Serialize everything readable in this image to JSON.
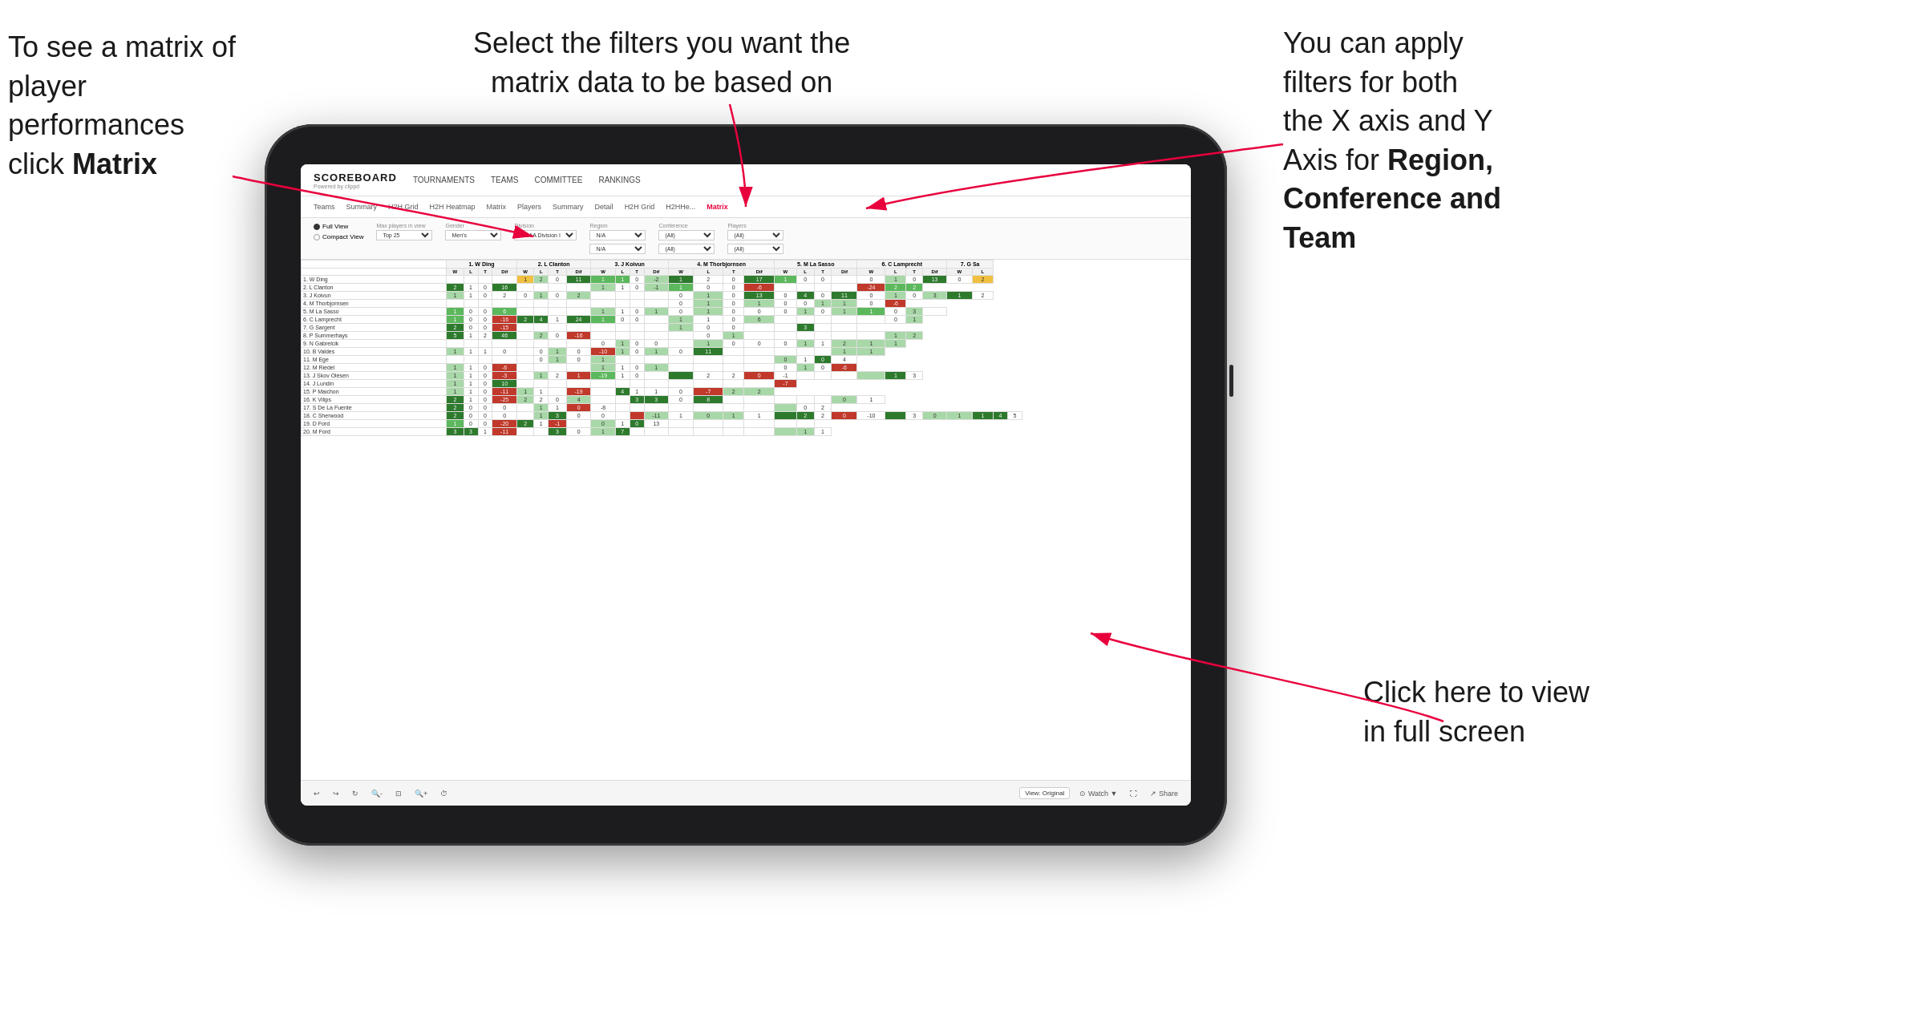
{
  "annotations": {
    "top_left": {
      "line1": "To see a matrix of",
      "line2": "player performances",
      "line3": "click ",
      "line3_bold": "Matrix"
    },
    "top_center": {
      "text": "Select the filters you want the\nmatrix data to be based on"
    },
    "top_right": {
      "line1": "You  can apply",
      "line2": "filters for both",
      "line3": "the X axis and Y",
      "line4_prefix": "Axis for ",
      "line4_bold": "Region,",
      "line5_bold": "Conference and",
      "line6_bold": "Team"
    },
    "bottom_right": {
      "line1": "Click here to view",
      "line2": "in full screen"
    }
  },
  "app": {
    "logo": "SCOREBOARD",
    "logo_sub": "Powered by clippd",
    "nav": [
      "TOURNAMENTS",
      "TEAMS",
      "COMMITTEE",
      "RANKINGS"
    ],
    "sub_nav": [
      "Teams",
      "Summary",
      "H2H Grid",
      "H2H Heatmap",
      "Matrix",
      "Players",
      "Summary",
      "Detail",
      "H2H Grid",
      "H2HHe...",
      "Matrix"
    ],
    "active_tab": "Matrix"
  },
  "filters": {
    "view_options": [
      "Full View",
      "Compact View"
    ],
    "active_view": "Full View",
    "max_players_label": "Max players in view",
    "max_players_value": "Top 25",
    "gender_label": "Gender",
    "gender_value": "Men's",
    "division_label": "Division",
    "division_value": "NCAA Division I",
    "region_label": "Region",
    "region_value": "N/A",
    "region_value2": "N/A",
    "conference_label": "Conference",
    "conference_value": "(All)",
    "conference_value2": "(All)",
    "players_label": "Players",
    "players_value": "(All)",
    "players_value2": "(All)"
  },
  "matrix": {
    "col_headers": [
      "1. W Ding",
      "2. L Clanton",
      "3. J Koivun",
      "4. M Thorbjornsen",
      "5. M La Sasso",
      "6. C Lamprecht",
      "7. G Sa"
    ],
    "sub_cols": [
      "W",
      "L",
      "T",
      "Dif"
    ],
    "rows": [
      {
        "name": "1. W Ding",
        "cells": [
          "",
          "",
          "",
          "",
          "1",
          "2",
          "0",
          "11",
          "1",
          "1",
          "0",
          "-2",
          "1",
          "2",
          "0",
          "17",
          "1",
          "0",
          "0",
          "",
          "0",
          "1",
          "0",
          "13",
          "0",
          "2"
        ]
      },
      {
        "name": "2. L Clanton",
        "cells": [
          "2",
          "1",
          "0",
          "16",
          "",
          "",
          "",
          "",
          "1",
          "1",
          "0",
          "-1",
          "1",
          "0",
          "0",
          "-6",
          "",
          "",
          "",
          "",
          "-24",
          "2",
          "2"
        ]
      },
      {
        "name": "3. J Koivun",
        "cells": [
          "1",
          "1",
          "0",
          "2",
          "0",
          "1",
          "0",
          "2",
          "",
          "",
          "",
          "",
          "0",
          "1",
          "0",
          "13",
          "0",
          "4",
          "0",
          "11",
          "0",
          "1",
          "0",
          "3",
          "1",
          "2"
        ]
      },
      {
        "name": "4. M Thorbjornsen",
        "cells": [
          "",
          "",
          "",
          "",
          "",
          "",
          "",
          "",
          "",
          "",
          "",
          "",
          "0",
          "1",
          "0",
          "1",
          "0",
          "0",
          "1",
          "1",
          "0",
          "-6"
        ]
      },
      {
        "name": "5. M La Sasso",
        "cells": [
          "1",
          "0",
          "0",
          "6",
          "",
          "",
          "",
          "",
          "1",
          "1",
          "0",
          "1",
          "0",
          "1",
          "0",
          "0",
          "0",
          "1",
          "0",
          "1",
          "1",
          "0",
          "3",
          ""
        ]
      },
      {
        "name": "6. C Lamprecht",
        "cells": [
          "1",
          "0",
          "0",
          "-16",
          "2",
          "4",
          "1",
          "24",
          "1",
          "0",
          "0",
          "",
          "1",
          "1",
          "0",
          "6",
          "",
          "",
          "",
          "",
          "",
          "0",
          "1"
        ]
      },
      {
        "name": "7. G Sargent",
        "cells": [
          "2",
          "0",
          "0",
          "-15",
          "",
          "",
          "",
          "",
          "",
          "",
          "",
          "",
          "1",
          "0",
          "0",
          "",
          "",
          "3",
          "",
          ""
        ]
      },
      {
        "name": "8. P Summerhays",
        "cells": [
          "5",
          "1",
          "2",
          "46",
          "",
          "2",
          "0",
          "-16",
          "",
          "",
          "",
          "",
          "",
          "0",
          "1",
          "",
          "",
          "",
          "",
          "",
          "",
          "1",
          "2"
        ]
      },
      {
        "name": "9. N Gabrelcik",
        "cells": [
          "",
          "",
          "",
          "",
          "",
          "",
          "",
          "",
          "0",
          "1",
          "0",
          "0",
          "",
          "1",
          "0",
          "0",
          "0",
          "1",
          "1",
          "2",
          "1",
          "1"
        ]
      },
      {
        "name": "10. B Valdes",
        "cells": [
          "1",
          "1",
          "1",
          "0",
          "",
          "0",
          "1",
          "0",
          "-10",
          "1",
          "0",
          "1",
          "0",
          "11",
          "",
          "",
          "",
          "",
          "",
          "1",
          "1"
        ]
      },
      {
        "name": "11. M Ege",
        "cells": [
          "",
          "",
          "",
          "",
          "",
          "0",
          "1",
          "0",
          "1",
          "",
          "",
          "",
          "",
          "",
          "",
          "",
          "0",
          "1",
          "0",
          "4"
        ]
      },
      {
        "name": "12. M Riedel",
        "cells": [
          "1",
          "1",
          "0",
          "-6",
          "",
          "",
          "",
          "",
          "1",
          "1",
          "0",
          "1",
          "",
          "",
          "",
          "",
          "0",
          "1",
          "0",
          "-6"
        ]
      },
      {
        "name": "13. J Skov Olesen",
        "cells": [
          "1",
          "1",
          "0",
          "-3",
          "",
          "1",
          "2",
          "1",
          "-19",
          "1",
          "0",
          "",
          "",
          "2",
          "2",
          "0",
          "-1",
          "",
          "",
          "",
          "",
          "1",
          "3"
        ]
      },
      {
        "name": "14. J Lundin",
        "cells": [
          "1",
          "1",
          "0",
          "10",
          "",
          "",
          "",
          "",
          "",
          "",
          "",
          "",
          "",
          "",
          "",
          "",
          "-7"
        ]
      },
      {
        "name": "15. P Maichon",
        "cells": [
          "1",
          "1",
          "0",
          "-11",
          "1",
          "1",
          "",
          "-19",
          "",
          "4",
          "1",
          "1",
          "0",
          "-7",
          "2",
          "2"
        ]
      },
      {
        "name": "16. K Vilips",
        "cells": [
          "2",
          "1",
          "0",
          "-25",
          "2",
          "2",
          "0",
          "4",
          "",
          "",
          "3",
          "3",
          "0",
          "8",
          "",
          "",
          "",
          "",
          "",
          "0",
          "1"
        ]
      },
      {
        "name": "17. S De La Fuente",
        "cells": [
          "2",
          "0",
          "0",
          "0",
          "",
          "1",
          "1",
          "0",
          "-8",
          "",
          "",
          "",
          "",
          "",
          "",
          "",
          "",
          "0",
          "2"
        ]
      },
      {
        "name": "18. C Sherwood",
        "cells": [
          "2",
          "0",
          "0",
          "0",
          "",
          "1",
          "3",
          "0",
          "0",
          "",
          "",
          "-11",
          "1",
          "0",
          "1",
          "1",
          "",
          "2",
          "2",
          "0",
          "-10",
          "",
          "3",
          "0",
          "1",
          "1",
          "4",
          "5"
        ]
      },
      {
        "name": "19. D Ford",
        "cells": [
          "1",
          "0",
          "0",
          "-20",
          "2",
          "1",
          "-1",
          "",
          "0",
          "1",
          "0",
          "13",
          "",
          "",
          "",
          "",
          "",
          ""
        ]
      },
      {
        "name": "20. M Ford",
        "cells": [
          "3",
          "3",
          "1",
          "-11",
          "",
          "",
          "3",
          "0",
          "1",
          "7",
          "",
          "",
          "",
          "",
          "",
          "",
          "",
          "1",
          "1"
        ]
      }
    ]
  },
  "toolbar": {
    "view_label": "View: Original",
    "watch_label": "Watch",
    "share_label": "Share"
  },
  "colors": {
    "accent": "#e8003d",
    "green_dark": "#2d7a2d",
    "green": "#5cb85c",
    "yellow": "#f0c040",
    "white": "#ffffff",
    "arrow": "#e8003d"
  }
}
